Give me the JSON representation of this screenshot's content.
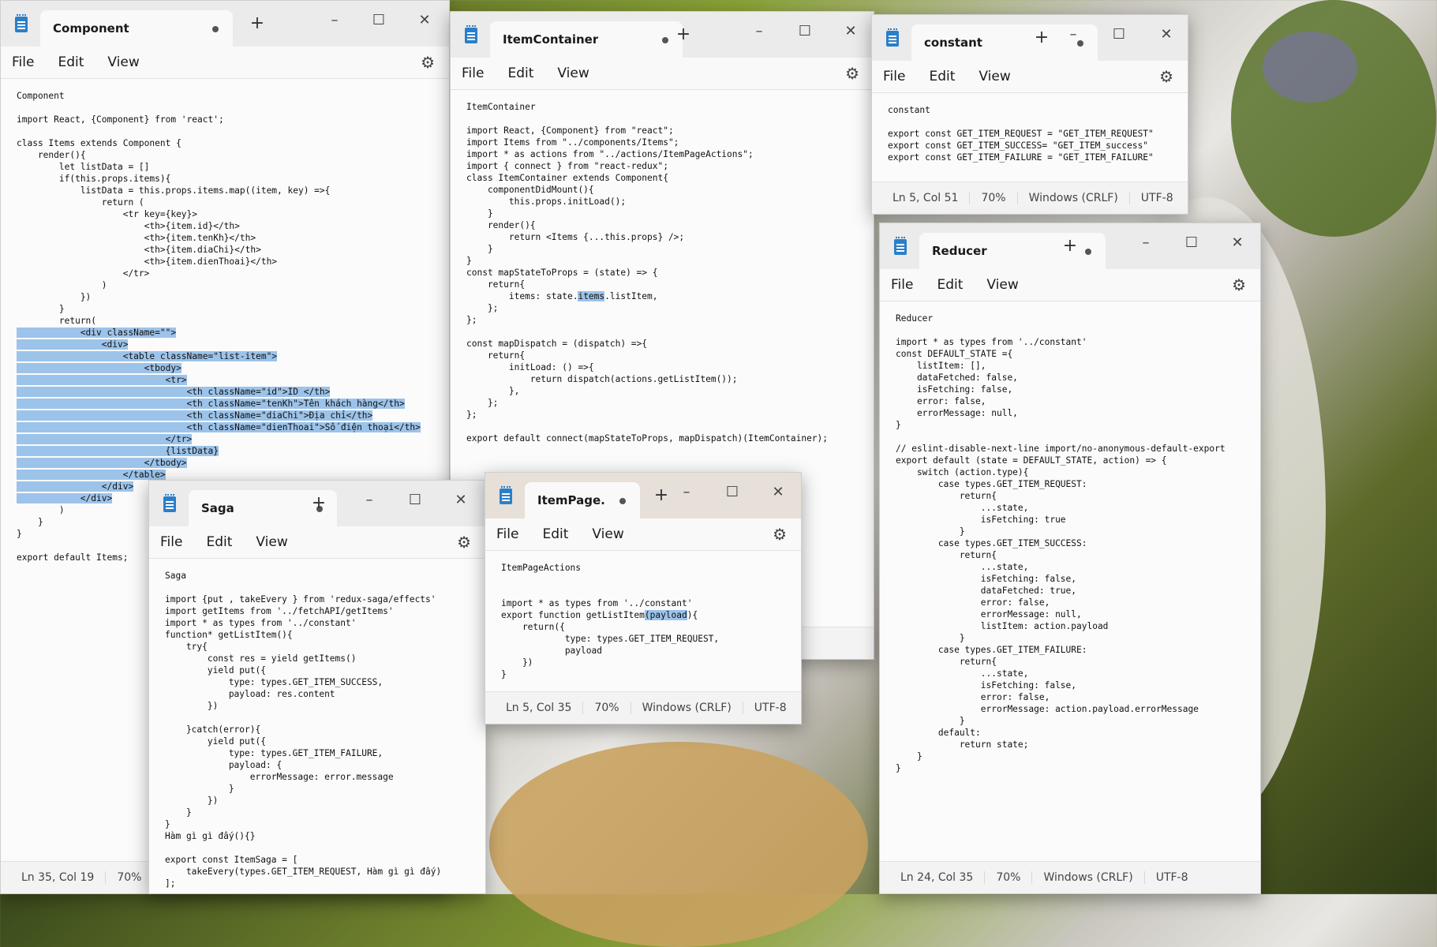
{
  "menus": {
    "file": "File",
    "edit": "Edit",
    "view": "View"
  },
  "windows": {
    "component": {
      "title": "Component",
      "code_before": "Component\n\nimport React, {Component} from 'react';\n\nclass Items extends Component {\n    render(){\n        let listData = []\n        if(this.props.items){\n            listData = this.props.items.map((item, key) =>{\n                return (\n                    <tr key={key}>\n                        <th>{item.id}</th>\n                        <th>{item.tenKh}</th>\n                        <th>{item.diaChi}</th>\n                        <th>{item.dienThoai}</th>\n                    </tr>\n                )\n            })\n        }\n        return(\n",
      "code_selected": "            <div className=\"\">\n                <div>\n                    <table className=\"list-item\">\n                        <tbody>\n                            <tr>\n                                <th className=\"id\">ID </th>\n                                <th className=\"tenKh\">Tên khách hàng</th>\n                                <th className=\"diaChi\">Địa chỉ</th>\n                                <th className=\"dienThoai\">Số điện thoại</th>\n                            </tr>\n                            {listData}\n                        </tbody>\n                    </table>\n                </div>\n            </div>",
      "code_after": "\n        )\n    }\n}\n\nexport default Items;",
      "status": {
        "pos": "Ln 35, Col 19",
        "zoom": "70%"
      }
    },
    "item_container": {
      "title": "ItemContainer",
      "code_before": "ItemContainer\n\nimport React, {Component} from \"react\";\nimport Items from \"../components/Items\";\nimport * as actions from \"../actions/ItemPageActions\";\nimport { connect } from \"react-redux\";\nclass ItemContainer extends Component{\n    componentDidMount(){\n        this.props.initLoad();\n    }\n    render(){\n        return <Items {...this.props} />;\n    }\n}\nconst mapStateToProps = (state) => {\n    return{\n        items: state.",
      "code_selected": "items",
      "code_after": ".listItem,\n    };\n};\n\nconst mapDispatch = (dispatch) =>{\n    return{\n        initLoad: () =>{\n            return dispatch(actions.getListItem());\n        },\n    };\n};\n\nexport default connect(mapStateToProps, mapDispatch)(ItemContainer);"
    },
    "constant": {
      "title": "constant",
      "code": "constant\n\nexport const GET_ITEM_REQUEST = \"GET_ITEM_REQUEST\"\nexport const GET_ITEM_SUCCESS= \"GET_ITEM_success\"\nexport const GET_ITEM_FAILURE = \"GET_ITEM_FAILURE\"",
      "status": {
        "pos": "Ln 5, Col 51",
        "zoom": "70%",
        "eol": "Windows (CRLF)",
        "enc": "UTF-8"
      }
    },
    "reducer": {
      "title": "Reducer",
      "code": "Reducer\n\nimport * as types from '../constant'\nconst DEFAULT_STATE ={\n    listItem: [],\n    dataFetched: false,\n    isFetching: false,\n    error: false,\n    errorMessage: null,\n}\n\n// eslint-disable-next-line import/no-anonymous-default-export\nexport default (state = DEFAULT_STATE, action) => {\n    switch (action.type){\n        case types.GET_ITEM_REQUEST:\n            return{\n                ...state,\n                isFetching: true\n            }\n        case types.GET_ITEM_SUCCESS:\n            return{\n                ...state,\n                isFetching: false,\n                dataFetched: true,\n                error: false,\n                errorMessage: null,\n                listItem: action.payload\n            }\n        case types.GET_ITEM_FAILURE:\n            return{\n                ...state,\n                isFetching: false,\n                error: false,\n                errorMessage: action.payload.errorMessage\n            }\n        default:\n            return state;\n    }\n}",
      "status": {
        "pos": "Ln 24, Col 35",
        "zoom": "70%",
        "eol": "Windows (CRLF)",
        "enc": "UTF-8"
      }
    },
    "saga": {
      "title": "Saga",
      "code": "Saga\n\nimport {put , takeEvery } from 'redux-saga/effects'\nimport getItems from '../fetchAPI/getItems'\nimport * as types from '../constant'\nfunction* getListItem(){\n    try{\n        const res = yield getItems()\n        yield put({\n            type: types.GET_ITEM_SUCCESS,\n            payload: res.content\n        })\n\n    }catch(error){\n        yield put({\n            type: types.GET_ITEM_FAILURE,\n            payload: {\n                errorMessage: error.message\n            }\n        })\n    }\n}\nHàm gì gì đấy(){}\n\nexport const ItemSaga = [\n    takeEvery(types.GET_ITEM_REQUEST, Hàm gì gì đấy)\n];"
    },
    "item_page": {
      "title": "ItemPage.",
      "code_before": "ItemPageActions\n\n\nimport * as types from '../constant'\nexport function getListItem",
      "code_selected": "(payload",
      "code_after": "){\n    return({\n            type: types.GET_ITEM_REQUEST,\n            payload\n    })\n}",
      "status": {
        "pos": "Ln 5, Col 35",
        "zoom": "70%",
        "eol": "Windows (CRLF)",
        "enc": "UTF-8"
      }
    }
  }
}
